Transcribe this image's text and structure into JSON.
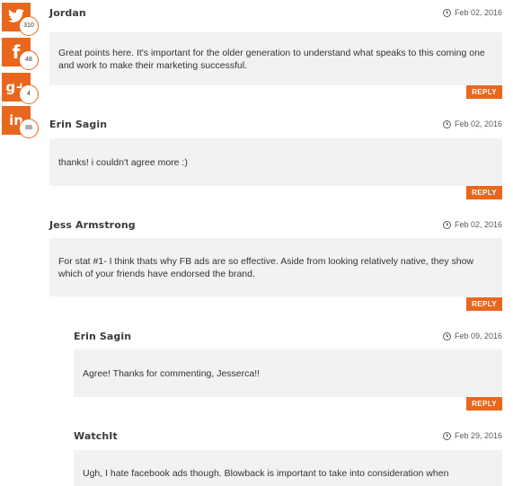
{
  "share": [
    {
      "network": "twitter",
      "icon": "twitter-icon",
      "glyph": "🐦",
      "count": "310"
    },
    {
      "network": "facebook",
      "icon": "facebook-icon",
      "glyph": "f",
      "count": "48"
    },
    {
      "network": "googleplus",
      "icon": "google-plus-icon",
      "glyph": "g+",
      "count": "4"
    },
    {
      "network": "linkedin",
      "icon": "linkedin-icon",
      "glyph": "in",
      "count": "88"
    }
  ],
  "comments": [
    {
      "author": "Jordan",
      "date": "Feb 02, 2016",
      "text": "Great points here. It's important for the older generation to understand what speaks to this coming one and work to make their marketing successful.",
      "reply_label": "REPLY"
    },
    {
      "author": "Erin Sagin",
      "date": "Feb 02, 2016",
      "text": "thanks! i couldn't agree more :)",
      "reply_label": "REPLY"
    },
    {
      "author": "Jess Armstrong",
      "date": "Feb 02, 2016",
      "text": "For stat #1- I think thats why FB ads are so effective. Aside from looking relatively native, they show which of your friends have endorsed the brand.",
      "reply_label": "REPLY"
    },
    {
      "author": "Erin Sagin",
      "date": "Feb 09, 2016",
      "text": "Agree! Thanks for commenting, Jesserca!!",
      "reply_label": "REPLY"
    },
    {
      "author": "WatchIt",
      "date": "Feb 29, 2016",
      "text": "Ugh, I hate facebook ads though. Blowback is important to take into consideration when"
    }
  ],
  "colors": {
    "accent": "#e8671d",
    "bubble": "#f2f2f2"
  }
}
